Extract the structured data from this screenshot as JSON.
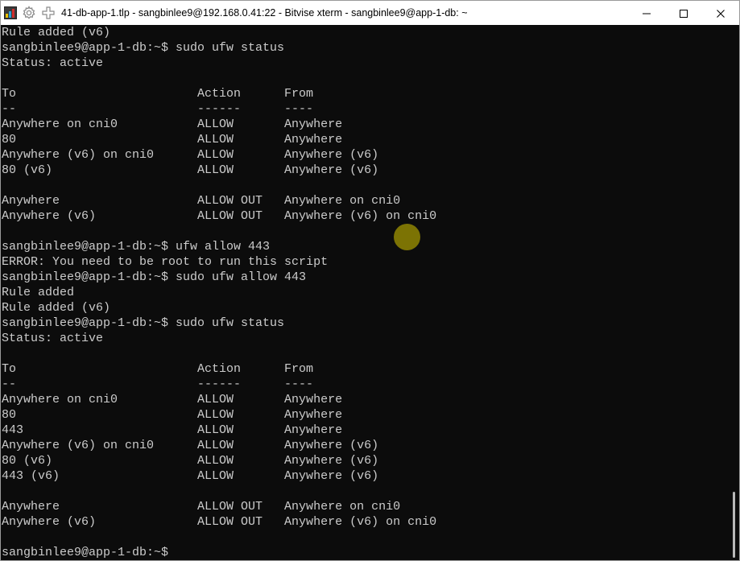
{
  "window": {
    "title": "41-db-app-1.tlp - sangbinlee9@192.168.0.41:22 - Bitvise xterm - sangbinlee9@app-1-db: ~",
    "icons": {
      "app": "bitvise-app-icon",
      "settings": "gear-icon",
      "new": "plus-icon",
      "minimize": "minimize-icon",
      "maximize": "maximize-icon",
      "close": "close-icon"
    }
  },
  "colors": {
    "terminal_bg": "#0c0c0c",
    "terminal_fg": "#cccccc",
    "cursor_highlight": "#c8b900"
  },
  "terminal": {
    "lines": [
      "Rule added (v6)",
      "sangbinlee9@app-1-db:~$ sudo ufw status",
      "Status: active",
      "",
      "To                         Action      From",
      "--                         ------      ----",
      "Anywhere on cni0           ALLOW       Anywhere",
      "80                         ALLOW       Anywhere",
      "Anywhere (v6) on cni0      ALLOW       Anywhere (v6)",
      "80 (v6)                    ALLOW       Anywhere (v6)",
      "",
      "Anywhere                   ALLOW OUT   Anywhere on cni0",
      "Anywhere (v6)              ALLOW OUT   Anywhere (v6) on cni0",
      "",
      "sangbinlee9@app-1-db:~$ ufw allow 443",
      "ERROR: You need to be root to run this script",
      "sangbinlee9@app-1-db:~$ sudo ufw allow 443",
      "Rule added",
      "Rule added (v6)",
      "sangbinlee9@app-1-db:~$ sudo ufw status",
      "Status: active",
      "",
      "To                         Action      From",
      "--                         ------      ----",
      "Anywhere on cni0           ALLOW       Anywhere",
      "80                         ALLOW       Anywhere",
      "443                        ALLOW       Anywhere",
      "Anywhere (v6) on cni0      ALLOW       Anywhere (v6)",
      "80 (v6)                    ALLOW       Anywhere (v6)",
      "443 (v6)                   ALLOW       Anywhere (v6)",
      "",
      "Anywhere                   ALLOW OUT   Anywhere on cni0",
      "Anywhere (v6)              ALLOW OUT   Anywhere (v6) on cni0",
      "",
      "sangbinlee9@app-1-db:~$"
    ]
  }
}
